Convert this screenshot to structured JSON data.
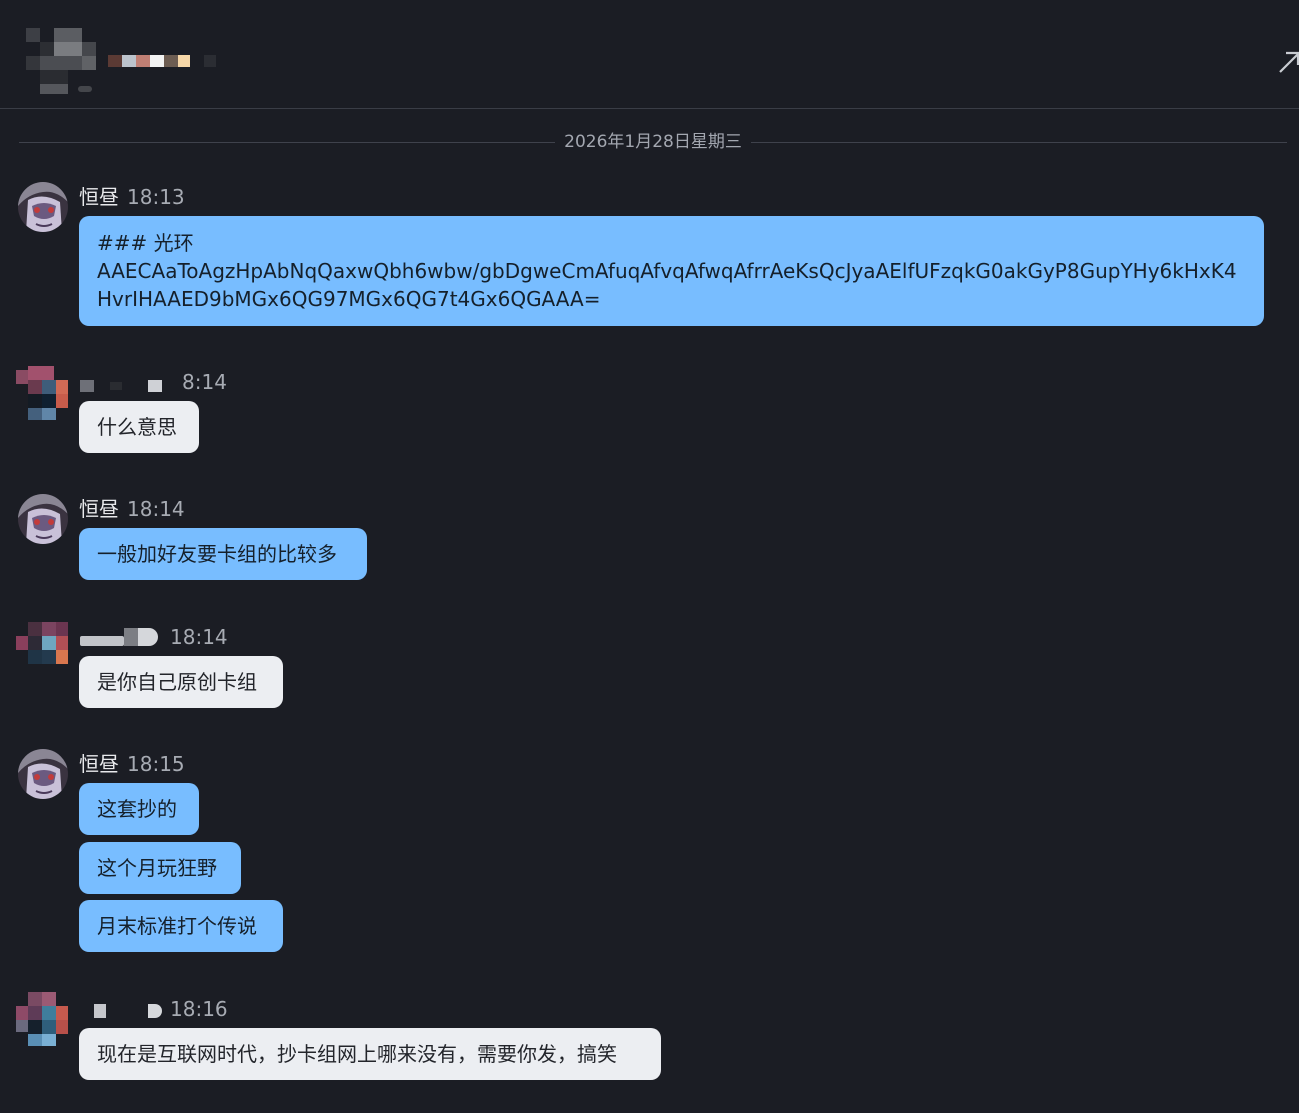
{
  "header": {
    "expand_icon": "arrow-up-right-icon"
  },
  "date_divider": "2026年1月28日星期三",
  "messages": [
    {
      "sender": "恒昼",
      "time": "18:13",
      "mine": true,
      "bubbles": [
        {
          "lines": [
            "### 光环",
            "AAECAaToAgzHpAbNqQaxwQbh6wbw/gbDgweCmAfuqAfvqAfwqAfrrAeKsQcJyaAElfUFzqkG0akGyP8GupYHy6kHxK4",
            "HvrIHAAED9bMGx6QG97MGx6QG7t4Gx6QGAAA="
          ]
        }
      ]
    },
    {
      "sender": "",
      "time": "8:14",
      "mine": false,
      "bubbles": [
        {
          "text": "什么意思"
        }
      ]
    },
    {
      "sender": "恒昼",
      "time": "18:14",
      "mine": true,
      "bubbles": [
        {
          "text": "一般加好友要卡组的比较多"
        }
      ]
    },
    {
      "sender": "",
      "time": "18:14",
      "mine": false,
      "bubbles": [
        {
          "text": "是你自己原创卡组"
        }
      ]
    },
    {
      "sender": "恒昼",
      "time": "18:15",
      "mine": true,
      "bubbles": [
        {
          "text": "这套抄的"
        },
        {
          "text": "这个月玩狂野"
        },
        {
          "text": "月末标准打个传说"
        }
      ]
    },
    {
      "sender": "",
      "time": "18:16",
      "mine": false,
      "bubbles": [
        {
          "text": "现在是互联网时代，抄卡组网上哪来没有，需要你发，搞笑"
        }
      ]
    }
  ],
  "colors": {
    "background": "#1b1d24",
    "mine_bubble": "#78bdff",
    "theirs_bubble": "#eceef2",
    "time_text": "#a7abb3"
  }
}
